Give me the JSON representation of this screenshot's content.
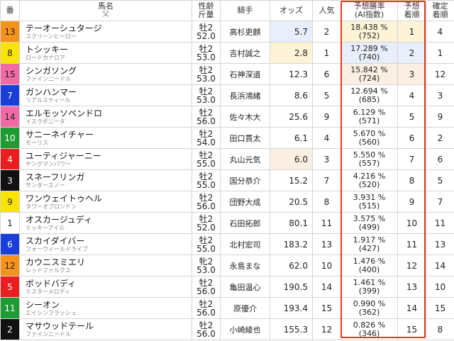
{
  "headers": {
    "num": "番",
    "horse": "馬名",
    "horse_sub": "父",
    "sexage": "性齢",
    "sexage_sub": "斤量",
    "jockey": "騎手",
    "odds": "オッズ",
    "pop": "人気",
    "rate": "予想勝率",
    "rate_sub": "(AI指数)",
    "pred": "予想",
    "pred_sub": "着順",
    "final": "確定",
    "final_sub": "着順"
  },
  "colors": {
    "frame_highlight": "#e8381c",
    "odds_pop1": "#fdf4d8",
    "odds_pop2": "#e8eefb",
    "odds_pop3": "#fbeee3"
  },
  "rows": [
    {
      "num": "13",
      "num_bg": "#f6921e",
      "num_fg": "#222",
      "name": "テーオーシュタージ",
      "sire": "スクリーンヒーロー",
      "sex": "牡2",
      "weight": "52.0",
      "jockey": "高杉吏麒",
      "odds": "5.7",
      "pop": "2",
      "rate": "18.438 %",
      "ai": "(752)",
      "pred": "1",
      "final": "4"
    },
    {
      "num": "8",
      "num_bg": "#f9e400",
      "num_fg": "#222",
      "name": "トシッキー",
      "sire": "ロードカナロア",
      "sex": "牡2",
      "weight": "53.0",
      "jockey": "吉村誠之",
      "odds": "2.8",
      "pop": "1",
      "rate": "17.289 %",
      "ai": "(740)",
      "pred": "2",
      "final": "1"
    },
    {
      "num": "15",
      "num_bg": "#f06aa5",
      "num_fg": "#222",
      "name": "シンガソング",
      "sire": "ファインニードル",
      "sex": "牡2",
      "weight": "53.0",
      "jockey": "石神深道",
      "odds": "12.3",
      "pop": "6",
      "rate": "15.842 %",
      "ai": "(724)",
      "pred": "3",
      "final": "12"
    },
    {
      "num": "7",
      "num_bg": "#1a3fd9",
      "num_fg": "#fff",
      "name": "ガンハンマー",
      "sire": "リアルスティール",
      "sex": "牡2",
      "weight": "53.0",
      "jockey": "長浜鴻緒",
      "odds": "8.6",
      "pop": "5",
      "rate": "12.694 %",
      "ai": "(685)",
      "pred": "4",
      "final": "3"
    },
    {
      "num": "14",
      "num_bg": "#f06aa5",
      "num_fg": "#222",
      "name": "エルモッソペンドロ",
      "sire": "イスラボニータ",
      "sex": "牡2",
      "weight": "56.0",
      "jockey": "佐々木大",
      "odds": "25.6",
      "pop": "9",
      "rate": "6.129 %",
      "ai": "(571)",
      "pred": "5",
      "final": "9"
    },
    {
      "num": "10",
      "num_bg": "#1f9b34",
      "num_fg": "#fff",
      "name": "サニーネイチャー",
      "sire": "モーリス",
      "sex": "牡2",
      "weight": "54.0",
      "jockey": "田口貫太",
      "odds": "6.1",
      "pop": "4",
      "rate": "5.670 %",
      "ai": "(560)",
      "pred": "6",
      "final": "2"
    },
    {
      "num": "4",
      "num_bg": "#e91f1f",
      "num_fg": "#fff",
      "name": "ユーティジャーニー",
      "sire": "ヤングマンパワー",
      "sex": "牡2",
      "weight": "55.0",
      "jockey": "丸山元気",
      "odds": "6.0",
      "pop": "3",
      "rate": "5.550 %",
      "ai": "(557)",
      "pred": "7",
      "final": "6"
    },
    {
      "num": "3",
      "num_bg": "#111111",
      "num_fg": "#fff",
      "name": "スネーフリンガ",
      "sire": "サンダースノー",
      "sex": "牡2",
      "weight": "55.0",
      "jockey": "国分恭介",
      "odds": "15.2",
      "pop": "7",
      "rate": "4.216 %",
      "ai": "(520)",
      "pred": "8",
      "final": "5"
    },
    {
      "num": "9",
      "num_bg": "#f9e400",
      "num_fg": "#222",
      "name": "ワンウェイトゥヘル",
      "sire": "タワーオブロンドン",
      "sex": "牡2",
      "weight": "56.0",
      "jockey": "団野大成",
      "odds": "20.5",
      "pop": "8",
      "rate": "3.931 %",
      "ai": "(515)",
      "pred": "9",
      "final": "7"
    },
    {
      "num": "1",
      "num_bg": "#ffffff",
      "num_fg": "#222",
      "name": "オスカージュディ",
      "sire": "ミッキーアイル",
      "sex": "牡2",
      "weight": "52.0",
      "jockey": "石田拓郎",
      "odds": "80.1",
      "pop": "11",
      "rate": "3.575 %",
      "ai": "(499)",
      "pred": "10",
      "final": "11"
    },
    {
      "num": "6",
      "num_bg": "#1a3fd9",
      "num_fg": "#fff",
      "name": "スカイダイバー",
      "sire": "フォーウィールドライブ",
      "sex": "牡2",
      "weight": "55.0",
      "jockey": "北村宏司",
      "odds": "183.2",
      "pop": "13",
      "rate": "1.917 %",
      "ai": "(427)",
      "pred": "11",
      "final": "13"
    },
    {
      "num": "12",
      "num_bg": "#f6921e",
      "num_fg": "#222",
      "name": "カウニスミエリ",
      "sire": "レッドファルクス",
      "sex": "牝2",
      "weight": "53.0",
      "jockey": "永島まな",
      "odds": "62.0",
      "pop": "10",
      "rate": "1.476 %",
      "ai": "(400)",
      "pred": "12",
      "final": "14"
    },
    {
      "num": "5",
      "num_bg": "#e91f1f",
      "num_fg": "#fff",
      "name": "ボッドバディ",
      "sire": "ミスターメロディ",
      "sex": "牡2",
      "weight": "56.0",
      "jockey": "亀田温心",
      "odds": "190.5",
      "pop": "14",
      "rate": "1.461 %",
      "ai": "(399)",
      "pred": "13",
      "final": "10"
    },
    {
      "num": "11",
      "num_bg": "#1f9b34",
      "num_fg": "#fff",
      "name": "シーオン",
      "sire": "エイシンフラッシュ",
      "sex": "牡2",
      "weight": "56.0",
      "jockey": "原優介",
      "odds": "193.4",
      "pop": "15",
      "rate": "0.990 %",
      "ai": "(362)",
      "pred": "14",
      "final": "15"
    },
    {
      "num": "2",
      "num_bg": "#111111",
      "num_fg": "#fff",
      "name": "マサウッドテール",
      "sire": "ファインニードル",
      "sex": "牡2",
      "weight": "56.0",
      "jockey": "小崎綾也",
      "odds": "155.3",
      "pop": "12",
      "rate": "0.826 %",
      "ai": "(346)",
      "pred": "15",
      "final": "8"
    }
  ]
}
